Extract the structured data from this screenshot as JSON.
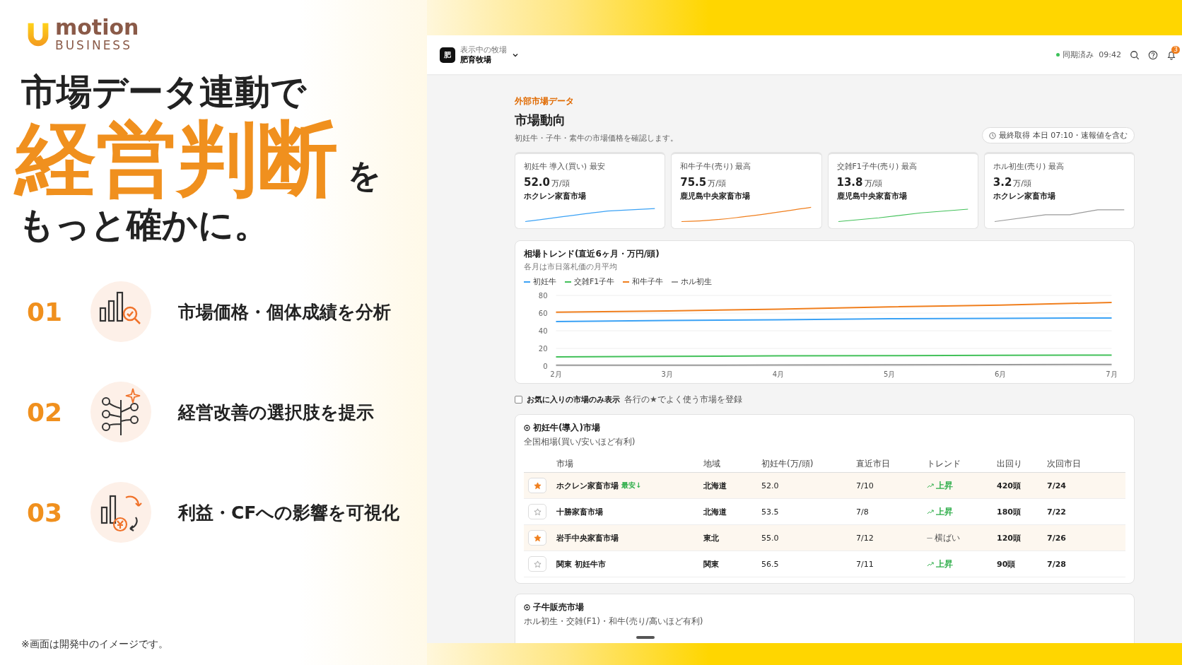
{
  "brand": {
    "name": "motion",
    "sub": "BUSINESS"
  },
  "headline": {
    "line1": "市場データ連動で",
    "emphasis": "経営判断",
    "particle": "を",
    "line2": "もっと確かに。"
  },
  "features": [
    {
      "number": "01",
      "kind": "analyze",
      "text": "市場価格・個体成績を分析"
    },
    {
      "number": "02",
      "kind": "options",
      "text": "経営改善の選択肢を提示"
    },
    {
      "number": "03",
      "kind": "profit",
      "text": "利益・CFへの影響を可視化"
    }
  ],
  "footnote": "※画面は開発中のイメージです。",
  "app": {
    "header": {
      "farm_avatar": "肥",
      "farm_caption": "表示中の牧場",
      "farm_name": "肥育牧場",
      "sync_status": "同期済み",
      "sync_time": "09:42",
      "notification_count": "3"
    },
    "page": {
      "eyebrow": "外部市場データ",
      "title": "市場動向",
      "subtitle": "初妊牛・子牛・素牛の市場価格を確認します。",
      "fetched": "最終取得 本日 07:10・速報値を含む"
    },
    "kpis": [
      {
        "label": "初妊牛 導入(買い) 最安",
        "value": "52.0",
        "unit": "万/頭",
        "market": "ホクレン家畜市場",
        "color": "#3ba2f5"
      },
      {
        "label": "和牛子牛(売り) 最高",
        "value": "75.5",
        "unit": "万/頭",
        "market": "鹿児島中央家畜市場",
        "color": "#f07f1e"
      },
      {
        "label": "交雑F1子牛(売り) 最高",
        "value": "13.8",
        "unit": "万/頭",
        "market": "鹿児島中央家畜市場",
        "color": "#43c15a"
      },
      {
        "label": "ホル初生(売り) 最高",
        "value": "3.2",
        "unit": "万/頭",
        "market": "ホクレン家畜市場",
        "color": "#9a9a9a"
      }
    ],
    "trend": {
      "title": "相場トレンド(直近6ヶ月・万円/頭)",
      "subtitle": "各月は市日落札価の月平均",
      "chart_data": {
        "type": "line",
        "grid": true,
        "categories": [
          "2月",
          "3月",
          "4月",
          "5月",
          "6月",
          "7月"
        ],
        "ylim": [
          0,
          80
        ],
        "yticks": [
          0,
          20,
          40,
          60,
          80
        ],
        "series": [
          {
            "name": "初妊牛",
            "color": "#3ba2f5",
            "values": [
              50.5,
              51.5,
              52.5,
              53.5,
              54,
              54.5
            ]
          },
          {
            "name": "交雑F1子牛",
            "color": "#43c15a",
            "values": [
              10.5,
              11,
              11.5,
              11.8,
              12.2,
              12.5
            ]
          },
          {
            "name": "和牛子牛",
            "color": "#f07f1e",
            "values": [
              61,
              62.5,
              64.5,
              67,
              69,
              72
            ]
          },
          {
            "name": "ホル初生",
            "color": "#9a9a9a",
            "values": [
              1,
              1,
              1.2,
              1.4,
              1.6,
              1.8
            ]
          }
        ]
      }
    },
    "favorites_filter": {
      "label": "お気に入りの市場のみ表示",
      "hint": "各行の★でよく使う市場を登録",
      "checked": false
    },
    "heifer_table": {
      "title": "初妊牛(導入)市場",
      "subtitle": "全国相場(買い/安いほど有利)",
      "columns": [
        "市場",
        "地域",
        "初妊牛(万/頭)",
        "直近市日",
        "トレンド",
        "出回り",
        "次回市日"
      ],
      "rows": [
        {
          "favorite": true,
          "market": "ホクレン家畜市場",
          "badge": "最安↓",
          "region": "北海道",
          "price": "52.0",
          "last_date": "7/10",
          "trend": {
            "kind": "up",
            "label": "上昇"
          },
          "supply": "420頭",
          "next_date": "7/24"
        },
        {
          "favorite": false,
          "market": "十勝家畜市場",
          "region": "北海道",
          "price": "53.5",
          "last_date": "7/8",
          "trend": {
            "kind": "up",
            "label": "上昇"
          },
          "supply": "180頭",
          "next_date": "7/22"
        },
        {
          "favorite": true,
          "market": "岩手中央家畜市場",
          "region": "東北",
          "price": "55.0",
          "last_date": "7/12",
          "trend": {
            "kind": "flat",
            "label": "横ばい"
          },
          "supply": "120頭",
          "next_date": "7/26"
        },
        {
          "favorite": false,
          "market": "関東 初妊牛市",
          "region": "関東",
          "price": "56.5",
          "last_date": "7/11",
          "trend": {
            "kind": "up",
            "label": "上昇"
          },
          "supply": "90頭",
          "next_date": "7/28"
        }
      ]
    },
    "calf_table": {
      "title": "子牛販売市場",
      "subtitle": "ホル初生・交雑(F1)・和牛(売り/高いほど有利)"
    }
  }
}
